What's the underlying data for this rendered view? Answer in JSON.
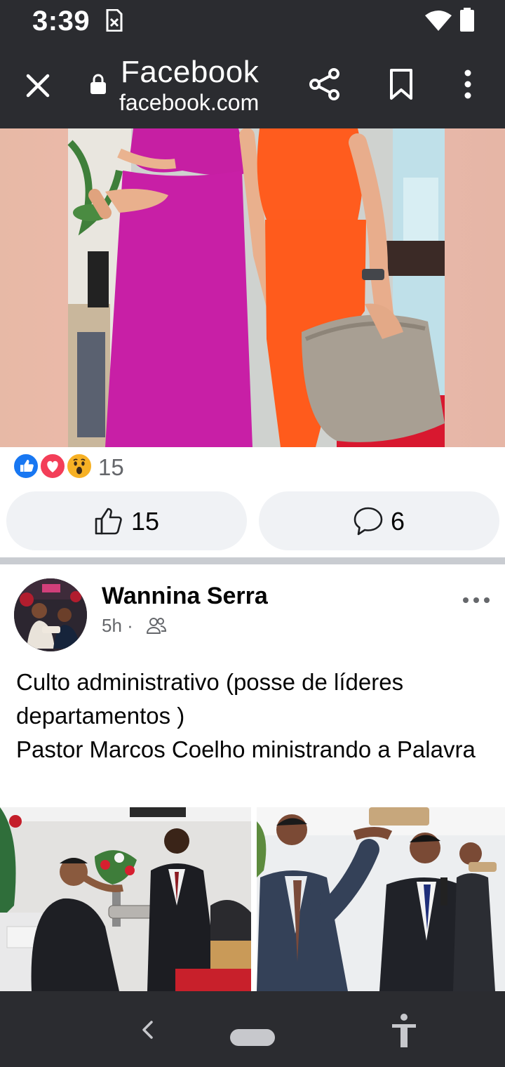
{
  "status_bar": {
    "time": "3:39",
    "icons": [
      "file-x-icon",
      "wifi-icon",
      "battery-icon"
    ]
  },
  "browser": {
    "title": "Facebook",
    "url": "facebook.com",
    "icons": [
      "close-icon",
      "lock-icon",
      "share-icon",
      "bookmark-icon",
      "more-vertical-icon"
    ]
  },
  "post1": {
    "reactions": [
      "like",
      "love",
      "wow"
    ],
    "reaction_count": "15",
    "like_count": "15",
    "comment_count": "6"
  },
  "post2": {
    "author": "Wannina Serra",
    "time": "5h",
    "audience_icon": "friends-icon",
    "text": "Culto administrativo (posse de líderes departamentos )\nPastor Marcos Coelho ministrando a Palavra"
  },
  "nav_bar": {
    "icons": [
      "back-icon",
      "home-pill",
      "accessibility-icon"
    ]
  },
  "colors": {
    "chrome": "#2b2c30",
    "facebook_blue": "#1877f2",
    "love_red": "#f33e58",
    "wow_yellow": "#f7b125",
    "button_bg": "#f0f2f5",
    "secondary_text": "#65676b"
  }
}
